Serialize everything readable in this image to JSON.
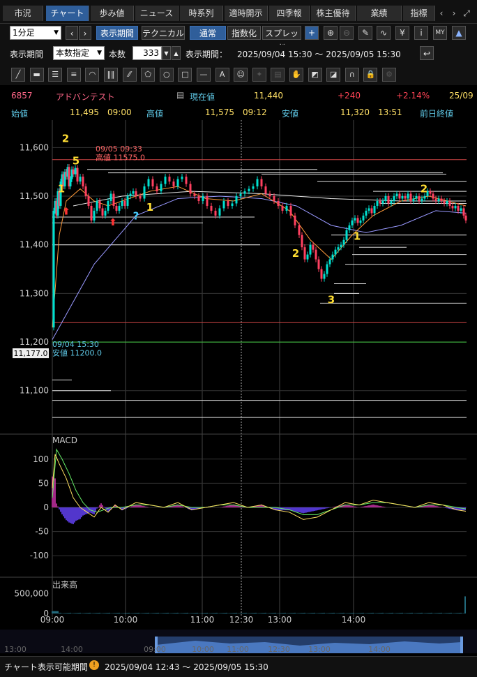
{
  "tabs": [
    "市況",
    "チャート",
    "歩み値",
    "ニュース",
    "時系列",
    "適時開示",
    "四季報",
    "株主優待",
    "業績",
    "指標"
  ],
  "active_tab": 1,
  "nav_icons": {
    "prev": "chevron-left-icon",
    "next": "chevron-right-icon",
    "expand": "expand-icon",
    "prev_glyph": "‹",
    "next_glyph": "›",
    "expand_glyph": "⤢"
  },
  "toolbar": {
    "interval": "1分足",
    "prev_glyph": "‹",
    "next_glyph": "›",
    "display_period_label": "表示期間",
    "technical_label": "テクニカル",
    "normal_label": "通常",
    "index_label": "指数化",
    "spread_label": "スプレッド",
    "icons": [
      "crosshair-icon",
      "zoom-in-icon",
      "zoom-out-icon",
      "pen-icon",
      "drawing-icon",
      "yen-icon",
      "info-icon",
      "my-icon",
      "area-chart-icon"
    ],
    "icon_glyphs": [
      "+",
      "⊕",
      "⊖",
      "✎",
      "∿",
      "¥",
      "i",
      "MY",
      "▲"
    ]
  },
  "period_row": {
    "label": "表示期間",
    "mode": "本数指定",
    "count_label": "本数",
    "count": "333",
    "range_label": "表示期間：",
    "range": "2025/09/04 15:30 ～ 2025/09/05 15:30",
    "return_glyph": "↩"
  },
  "draw_tools": {
    "icons": [
      "line-tool-icon",
      "ruler-icon",
      "h-lines-icon",
      "h-lines-2-icon",
      "arc-icon",
      "v-lines-icon",
      "fan-icon",
      "pentagon-icon",
      "circle-icon",
      "rectangle-icon",
      "hline-icon",
      "text-tool-icon",
      "icon-tool-icon",
      "cursor-icon",
      "memo-icon",
      "hand-icon",
      "eraser-icon",
      "eraser-2-icon",
      "magnet-icon",
      "lock-icon",
      "settings-icon"
    ],
    "glyphs": [
      "╱",
      "▬",
      "☰",
      "≡",
      "◠",
      "‖‖",
      "⁄⁄",
      "⬠",
      "○",
      "□",
      "—",
      "A",
      "☺",
      "✦",
      "▤",
      "✋",
      "◩",
      "◪",
      "∩",
      "🔒",
      "⚙"
    ]
  },
  "quote": {
    "code": "6857",
    "name": "アドバンテスト",
    "current_label": "現在値",
    "current": "11,440",
    "change": "+240",
    "change_pct": "+2.14%",
    "date": "25/09",
    "open_label": "始値",
    "open": "11,495",
    "open_time": "09:00",
    "high_label": "高値",
    "high": "11,575",
    "high_time": "09:12",
    "low_label": "安値",
    "low": "11,320",
    "low_time": "13:51",
    "prev_close_label": "前日終値"
  },
  "colors": {
    "up": "#00e0d0",
    "down": "#ff4060",
    "accent": "#2f5e9a",
    "ma_short": "#ff9a3a",
    "ma_mid": "#9999ff",
    "ma_long": "#e8e8e8",
    "macd": "#ffe060",
    "signal": "#66ee66"
  },
  "chart_data": {
    "type": "line",
    "price_axis": {
      "ticks": [
        11600,
        11500,
        11400,
        11300,
        11200,
        11100
      ],
      "tick_labels": [
        "11,600",
        "11,500",
        "11,400",
        "11,300",
        "11,200",
        "11,100"
      ],
      "ylim": [
        11025,
        11645
      ]
    },
    "prev_close_marker": "11,177.0",
    "annotations": {
      "high_date": "09/05 09:33",
      "high_text": "高値 11575.0",
      "low_date": "09/04 15:30",
      "low_text": "安値 11200.0"
    },
    "wave_labels": [
      {
        "text": "2",
        "x": 19,
        "y": 11611
      },
      {
        "text": "5",
        "x": 34,
        "y": 11565
      },
      {
        "text": "1",
        "x": 13,
        "y": 11508
      },
      {
        "text": "1",
        "x": 140,
        "y": 11470
      },
      {
        "text": "?",
        "x": 120,
        "y": 11452
      },
      {
        "text": "2",
        "x": 349,
        "y": 11375
      },
      {
        "text": "1",
        "x": 437,
        "y": 11410
      },
      {
        "text": "3",
        "x": 400,
        "y": 11280
      },
      {
        "text": "2",
        "x": 533,
        "y": 11508
      }
    ],
    "price_series": [
      [
        0,
        11230
      ],
      [
        2,
        11470
      ],
      [
        4,
        11490
      ],
      [
        6,
        11460
      ],
      [
        8,
        11510
      ],
      [
        10,
        11480
      ],
      [
        12,
        11530
      ],
      [
        14,
        11545
      ],
      [
        16,
        11520
      ],
      [
        18,
        11550
      ],
      [
        20,
        11540
      ],
      [
        22,
        11560
      ],
      [
        24,
        11520
      ],
      [
        26,
        11535
      ],
      [
        28,
        11555
      ],
      [
        30,
        11545
      ],
      [
        33,
        11558
      ],
      [
        36,
        11530
      ],
      [
        40,
        11540
      ],
      [
        44,
        11520
      ],
      [
        48,
        11500
      ],
      [
        52,
        11480
      ],
      [
        56,
        11450
      ],
      [
        60,
        11470
      ],
      [
        64,
        11490
      ],
      [
        68,
        11475
      ],
      [
        72,
        11460
      ],
      [
        76,
        11470
      ],
      [
        80,
        11490
      ],
      [
        84,
        11505
      ],
      [
        88,
        11480
      ],
      [
        92,
        11470
      ],
      [
        96,
        11480
      ],
      [
        100,
        11490
      ],
      [
        104,
        11480
      ],
      [
        108,
        11500
      ],
      [
        112,
        11505
      ],
      [
        116,
        11510
      ],
      [
        120,
        11500
      ],
      [
        126,
        11495
      ],
      [
        132,
        11520
      ],
      [
        138,
        11535
      ],
      [
        144,
        11520
      ],
      [
        150,
        11510
      ],
      [
        156,
        11525
      ],
      [
        162,
        11540
      ],
      [
        168,
        11530
      ],
      [
        174,
        11520
      ],
      [
        180,
        11535
      ],
      [
        186,
        11540
      ],
      [
        192,
        11525
      ],
      [
        198,
        11505
      ],
      [
        204,
        11500
      ],
      [
        210,
        11490
      ],
      [
        216,
        11500
      ],
      [
        222,
        11480
      ],
      [
        228,
        11470
      ],
      [
        234,
        11460
      ],
      [
        240,
        11475
      ],
      [
        246,
        11490
      ],
      [
        252,
        11480
      ],
      [
        258,
        11485
      ],
      [
        264,
        11500
      ],
      [
        270,
        11505
      ],
      [
        276,
        11510
      ],
      [
        282,
        11515
      ],
      [
        288,
        11520
      ],
      [
        294,
        11535
      ],
      [
        300,
        11520
      ],
      [
        306,
        11505
      ],
      [
        312,
        11500
      ],
      [
        318,
        11490
      ],
      [
        324,
        11480
      ],
      [
        330,
        11470
      ],
      [
        336,
        11480
      ],
      [
        342,
        11460
      ],
      [
        348,
        11440
      ],
      [
        354,
        11420
      ],
      [
        358,
        11395
      ],
      [
        362,
        11370
      ],
      [
        366,
        11380
      ],
      [
        370,
        11400
      ],
      [
        374,
        11390
      ],
      [
        378,
        11370
      ],
      [
        382,
        11350
      ],
      [
        386,
        11330
      ],
      [
        390,
        11340
      ],
      [
        394,
        11360
      ],
      [
        398,
        11370
      ],
      [
        402,
        11380
      ],
      [
        406,
        11390
      ],
      [
        410,
        11395
      ],
      [
        414,
        11400
      ],
      [
        418,
        11410
      ],
      [
        422,
        11430
      ],
      [
        426,
        11440
      ],
      [
        430,
        11450
      ],
      [
        434,
        11455
      ],
      [
        438,
        11445
      ],
      [
        442,
        11450
      ],
      [
        446,
        11460
      ],
      [
        450,
        11470
      ],
      [
        454,
        11475
      ],
      [
        458,
        11465
      ],
      [
        462,
        11480
      ],
      [
        466,
        11490
      ],
      [
        470,
        11485
      ],
      [
        474,
        11490
      ],
      [
        478,
        11500
      ],
      [
        482,
        11485
      ],
      [
        486,
        11490
      ],
      [
        490,
        11500
      ],
      [
        494,
        11505
      ],
      [
        498,
        11495
      ],
      [
        502,
        11500
      ],
      [
        506,
        11495
      ],
      [
        510,
        11505
      ],
      [
        514,
        11490
      ],
      [
        518,
        11495
      ],
      [
        522,
        11500
      ],
      [
        526,
        11490
      ],
      [
        530,
        11495
      ],
      [
        534,
        11500
      ],
      [
        538,
        11510
      ],
      [
        542,
        11505
      ],
      [
        546,
        11495
      ],
      [
        550,
        11490
      ],
      [
        554,
        11495
      ],
      [
        558,
        11490
      ],
      [
        562,
        11485
      ],
      [
        566,
        11490
      ],
      [
        570,
        11480
      ],
      [
        574,
        11475
      ],
      [
        578,
        11480
      ],
      [
        582,
        11470
      ],
      [
        586,
        11475
      ],
      [
        590,
        11460
      ],
      [
        593,
        11450
      ]
    ],
    "ma_short": [
      [
        0,
        11230
      ],
      [
        10,
        11420
      ],
      [
        20,
        11490
      ],
      [
        40,
        11515
      ],
      [
        60,
        11490
      ],
      [
        80,
        11480
      ],
      [
        100,
        11490
      ],
      [
        140,
        11510
      ],
      [
        180,
        11520
      ],
      [
        220,
        11495
      ],
      [
        260,
        11490
      ],
      [
        300,
        11505
      ],
      [
        340,
        11470
      ],
      [
        370,
        11410
      ],
      [
        400,
        11370
      ],
      [
        430,
        11420
      ],
      [
        460,
        11460
      ],
      [
        500,
        11490
      ],
      [
        540,
        11500
      ],
      [
        593,
        11480
      ]
    ],
    "ma_mid": [
      [
        0,
        11205
      ],
      [
        60,
        11360
      ],
      [
        120,
        11460
      ],
      [
        180,
        11495
      ],
      [
        240,
        11500
      ],
      [
        300,
        11495
      ],
      [
        350,
        11480
      ],
      [
        400,
        11440
      ],
      [
        450,
        11425
      ],
      [
        500,
        11440
      ],
      [
        550,
        11470
      ],
      [
        593,
        11465
      ]
    ],
    "ma_long": [
      [
        30,
        11480
      ],
      [
        100,
        11500
      ],
      [
        200,
        11510
      ],
      [
        300,
        11505
      ],
      [
        400,
        11495
      ],
      [
        500,
        11490
      ],
      [
        593,
        11490
      ]
    ],
    "support_lines": [
      {
        "y": 11575,
        "x1": 0,
        "x2": 594,
        "color": "#cc4444"
      },
      {
        "y": 11555,
        "x1": 50,
        "x2": 380,
        "color": "#dddddd"
      },
      {
        "y": 11548,
        "x1": 80,
        "x2": 560,
        "color": "#dddddd"
      },
      {
        "y": 11545,
        "x1": 300,
        "x2": 565,
        "color": "#dddddd"
      },
      {
        "y": 11530,
        "x1": 380,
        "x2": 594,
        "color": "#dddddd"
      },
      {
        "y": 11510,
        "x1": 460,
        "x2": 594,
        "color": "#dddddd"
      },
      {
        "y": 11485,
        "x1": 470,
        "x2": 594,
        "color": "#dddddd"
      },
      {
        "y": 11457,
        "x1": 0,
        "x2": 290,
        "color": "#dddddd"
      },
      {
        "y": 11445,
        "x1": 0,
        "x2": 216,
        "color": "#dddddd"
      },
      {
        "y": 11400,
        "x1": 0,
        "x2": 298,
        "color": "#dddddd"
      },
      {
        "y": 11420,
        "x1": 400,
        "x2": 594,
        "color": "#dddddd"
      },
      {
        "y": 11395,
        "x1": 440,
        "x2": 508,
        "color": "#dddddd"
      },
      {
        "y": 11380,
        "x1": 430,
        "x2": 594,
        "color": "#dddddd"
      },
      {
        "y": 11360,
        "x1": 420,
        "x2": 594,
        "color": "#dddddd"
      },
      {
        "y": 11320,
        "x1": 404,
        "x2": 450,
        "color": "#dddddd"
      },
      {
        "y": 11300,
        "x1": 404,
        "x2": 440,
        "color": "#dddddd"
      },
      {
        "y": 11280,
        "x1": 384,
        "x2": 594,
        "color": "#dddddd"
      },
      {
        "y": 11240,
        "x1": 0,
        "x2": 594,
        "color": "#cc4444"
      },
      {
        "y": 11200,
        "x1": 0,
        "x2": 594,
        "color": "#44cc44"
      },
      {
        "y": 11122,
        "x1": 0,
        "x2": 28,
        "color": "#dddddd"
      },
      {
        "y": 11100,
        "x1": 0,
        "x2": 84,
        "color": "#dddddd"
      },
      {
        "y": 11080,
        "x1": 0,
        "x2": 594,
        "color": "#dddddd"
      },
      {
        "y": 11045,
        "x1": 0,
        "x2": 594,
        "color": "#dddddd"
      }
    ],
    "macd_axis": {
      "label": "MACD",
      "ticks": [
        100,
        50,
        0,
        -50,
        -100
      ],
      "tick_labels": [
        "100",
        "50",
        "0",
        "-50",
        "-100"
      ],
      "ylim": [
        -130,
        130
      ]
    },
    "macd_line": [
      [
        0,
        40
      ],
      [
        4,
        110
      ],
      [
        10,
        90
      ],
      [
        20,
        60
      ],
      [
        30,
        20
      ],
      [
        40,
        0
      ],
      [
        50,
        -10
      ],
      [
        60,
        -20
      ],
      [
        70,
        0
      ],
      [
        80,
        -10
      ],
      [
        90,
        5
      ],
      [
        100,
        -5
      ],
      [
        120,
        10
      ],
      [
        140,
        5
      ],
      [
        160,
        0
      ],
      [
        180,
        10
      ],
      [
        200,
        -5
      ],
      [
        220,
        0
      ],
      [
        240,
        5
      ],
      [
        260,
        10
      ],
      [
        280,
        0
      ],
      [
        300,
        5
      ],
      [
        320,
        -5
      ],
      [
        340,
        -10
      ],
      [
        360,
        -25
      ],
      [
        380,
        -20
      ],
      [
        400,
        -5
      ],
      [
        420,
        10
      ],
      [
        440,
        5
      ],
      [
        460,
        15
      ],
      [
        480,
        10
      ],
      [
        500,
        5
      ],
      [
        520,
        0
      ],
      [
        540,
        10
      ],
      [
        560,
        5
      ],
      [
        580,
        -5
      ],
      [
        593,
        -8
      ]
    ],
    "signal_line": [
      [
        0,
        20
      ],
      [
        6,
        120
      ],
      [
        14,
        100
      ],
      [
        24,
        70
      ],
      [
        34,
        35
      ],
      [
        44,
        10
      ],
      [
        54,
        -5
      ],
      [
        64,
        -10
      ],
      [
        74,
        -5
      ],
      [
        84,
        0
      ],
      [
        100,
        0
      ],
      [
        120,
        5
      ],
      [
        140,
        5
      ],
      [
        160,
        0
      ],
      [
        180,
        5
      ],
      [
        200,
        0
      ],
      [
        220,
        0
      ],
      [
        240,
        5
      ],
      [
        260,
        5
      ],
      [
        280,
        0
      ],
      [
        300,
        0
      ],
      [
        320,
        0
      ],
      [
        340,
        -5
      ],
      [
        360,
        -15
      ],
      [
        380,
        -15
      ],
      [
        400,
        -5
      ],
      [
        420,
        5
      ],
      [
        440,
        5
      ],
      [
        460,
        10
      ],
      [
        480,
        10
      ],
      [
        500,
        5
      ],
      [
        520,
        0
      ],
      [
        540,
        5
      ],
      [
        560,
        5
      ],
      [
        580,
        0
      ],
      [
        593,
        -3
      ]
    ],
    "volume_axis": {
      "label": "出来高",
      "ticks": [
        500000,
        0
      ],
      "tick_labels": [
        "500,000",
        "0"
      ],
      "ylim": [
        0,
        650000
      ]
    },
    "x_axis": {
      "ticks": [
        0,
        105,
        215,
        271,
        326,
        432
      ],
      "tick_labels": [
        "09:00",
        "10:00",
        "11:00",
        "12:30",
        "13:00",
        "14:00"
      ],
      "dashed_x": [
        271
      ]
    },
    "navigator": {
      "tick_labels": [
        "13:00",
        "14:00",
        "09:00",
        "10:00",
        "11:00",
        "12:30",
        "13:00",
        "14:00"
      ]
    }
  },
  "bottom": {
    "label": "チャート表示可能期間",
    "range": "2025/09/04 12:43 ～ 2025/09/05 15:30"
  }
}
